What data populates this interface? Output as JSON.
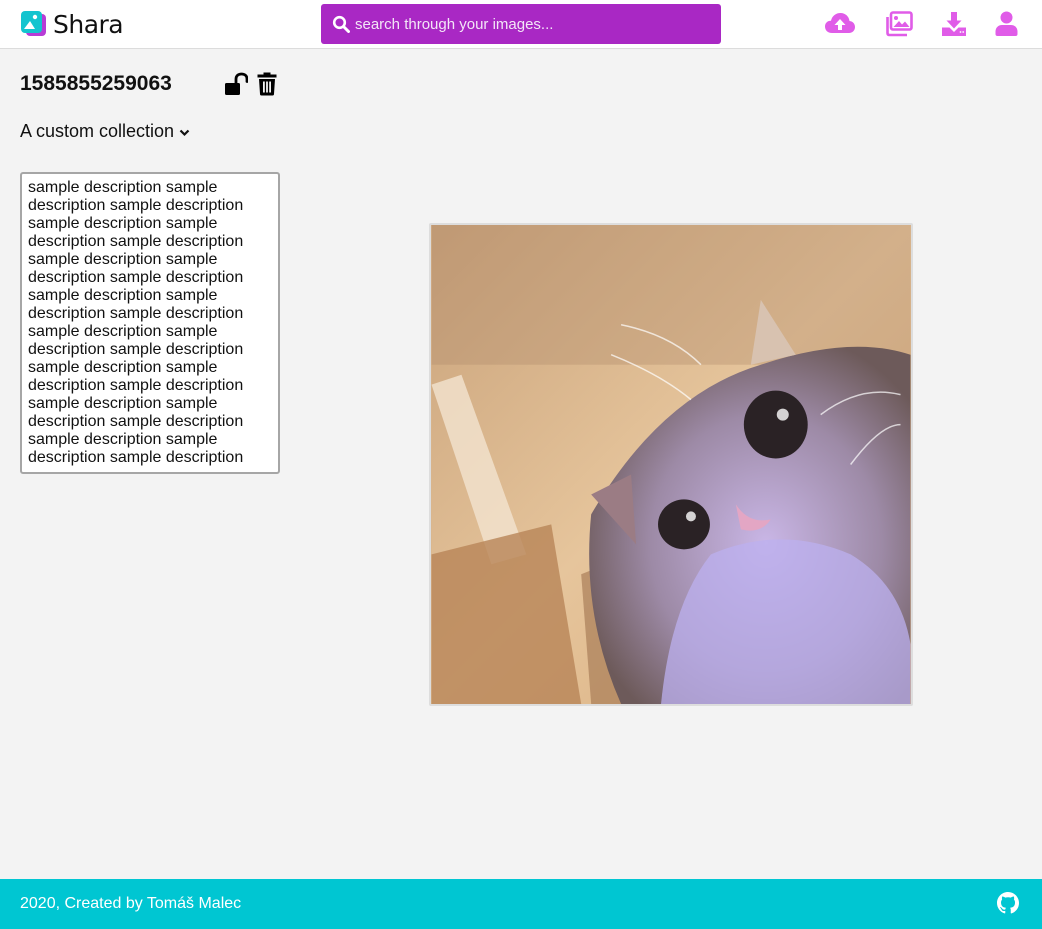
{
  "app": {
    "name": "Shara"
  },
  "search": {
    "placeholder": "search through your images..."
  },
  "header_icons": [
    "upload-cloud-icon",
    "gallery-icon",
    "download-icon",
    "user-icon"
  ],
  "image": {
    "title": "1585855259063",
    "collection": "A custom collection",
    "description": "sample description sample description sample description sample description sample description sample description sample description sample description sample description sample description sample description sample description sample description sample description sample description sample description sample description sample description sample description sample description sample description sample description sample description sample description",
    "lock_icon": "unlock-icon",
    "delete_icon": "trash-icon"
  },
  "footer": {
    "text": "2020, Created by Tomáš Malec",
    "icon": "github-icon"
  },
  "colors": {
    "accent": "#a928c4",
    "icon": "#e05ce8",
    "footer": "#00c6d2",
    "logo": "#14c4cf"
  }
}
